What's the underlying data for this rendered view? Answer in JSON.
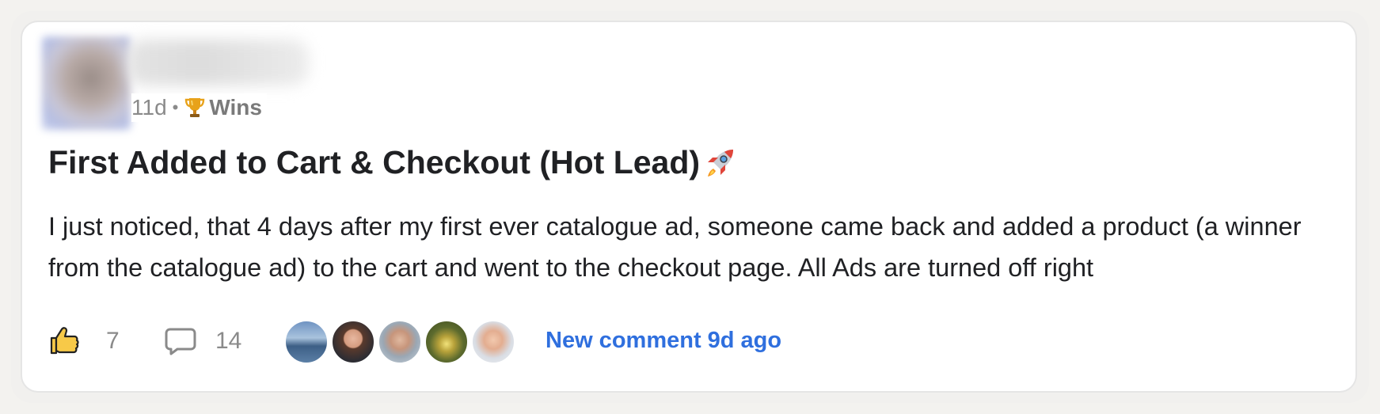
{
  "post": {
    "time_ago": "11d",
    "separator": "•",
    "category": "Wins",
    "category_icon": "trophy-icon",
    "title": "First Added to Cart & Checkout (Hot Lead)",
    "title_icon": "rocket-icon",
    "body": "I just noticed, that 4 days after my first ever catalogue ad, someone came back and added a product (a winner from the catalogue ad) to the cart and went to the checkout page. All Ads are turned off right"
  },
  "footer": {
    "like_icon": "thumbs-up-icon",
    "like_count": "7",
    "comment_icon": "comment-bubble-icon",
    "comment_count": "14",
    "commenters": [
      {
        "icon": "commenter-avatar"
      },
      {
        "icon": "commenter-avatar"
      },
      {
        "icon": "commenter-avatar"
      },
      {
        "icon": "commenter-avatar"
      },
      {
        "icon": "commenter-avatar"
      }
    ],
    "new_comment_text": "New comment 9d ago"
  },
  "colors": {
    "accent": "#2f6fde",
    "text_primary": "#202124",
    "text_muted": "#8a8a8a",
    "like_yellow": "#f7c948"
  }
}
